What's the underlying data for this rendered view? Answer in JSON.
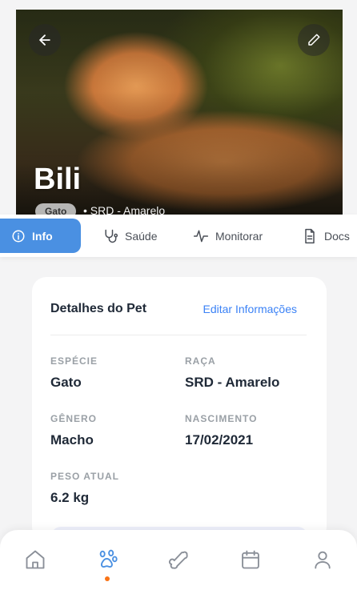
{
  "pet": {
    "name": "Bili",
    "species_chip": "Gato",
    "breed_subtitle": "• SRD - Amarelo"
  },
  "tabs": [
    {
      "label": "Info",
      "icon": "info-icon",
      "active": true
    },
    {
      "label": "Saúde",
      "icon": "stethoscope-icon",
      "active": false
    },
    {
      "label": "Monitorar",
      "icon": "activity-icon",
      "active": false
    },
    {
      "label": "Docs",
      "icon": "document-icon",
      "active": false
    }
  ],
  "details": {
    "title": "Detalhes do Pet",
    "edit_link": "Editar Informações",
    "fields": [
      {
        "label": "ESPÉCIE",
        "value": "Gato"
      },
      {
        "label": "RAÇA",
        "value": "SRD - Amarelo"
      },
      {
        "label": "GÊNERO",
        "value": "Macho"
      },
      {
        "label": "NASCIMENTO",
        "value": "17/02/2021"
      },
      {
        "label": "PESO ATUAL",
        "value": "6.2 kg"
      }
    ]
  },
  "bottom_nav": [
    {
      "icon": "home-icon",
      "active": false
    },
    {
      "icon": "paw-icon",
      "active": true
    },
    {
      "icon": "bone-icon",
      "active": false
    },
    {
      "icon": "calendar-icon",
      "active": false
    },
    {
      "icon": "user-icon",
      "active": false
    }
  ],
  "colors": {
    "accent": "#4a90e2",
    "active_dot": "#f97316",
    "link": "#3b82f6"
  }
}
